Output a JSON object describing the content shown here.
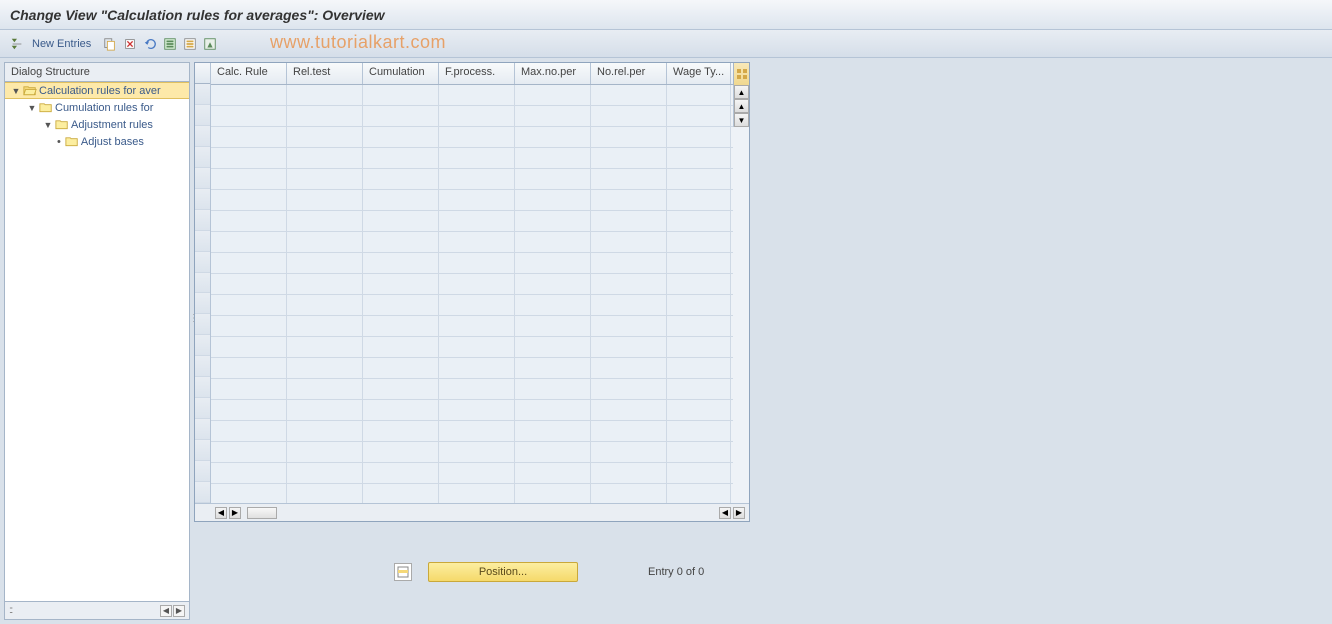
{
  "title": "Change View \"Calculation rules for averages\": Overview",
  "toolbar": {
    "new_entries": "New Entries"
  },
  "watermark": "www.tutorialkart.com",
  "sidebar": {
    "header": "Dialog Structure",
    "items": [
      {
        "label": "Calculation rules for aver",
        "level": 1,
        "expanded": true,
        "selected": true,
        "folder_open": true
      },
      {
        "label": "Cumulation rules for",
        "level": 2,
        "expanded": true,
        "selected": false,
        "folder_open": false
      },
      {
        "label": "Adjustment rules",
        "level": 3,
        "expanded": true,
        "selected": false,
        "folder_open": false
      },
      {
        "label": "Adjust bases",
        "level": 4,
        "expanded": false,
        "selected": false,
        "folder_open": false,
        "leaf": true
      }
    ]
  },
  "table": {
    "columns": [
      "Calc. Rule",
      "Rel.test",
      "Cumulation",
      "F.process.",
      "Max.no.per",
      "No.rel.per",
      "Wage Ty..."
    ],
    "empty_rows": 20,
    "config_icon": "▦"
  },
  "footer": {
    "position_label": "Position...",
    "entry_text": "Entry 0 of 0"
  },
  "colors": {
    "accent": "#fde9a9",
    "link": "#3a5a8a",
    "border": "#a5b5c8"
  }
}
